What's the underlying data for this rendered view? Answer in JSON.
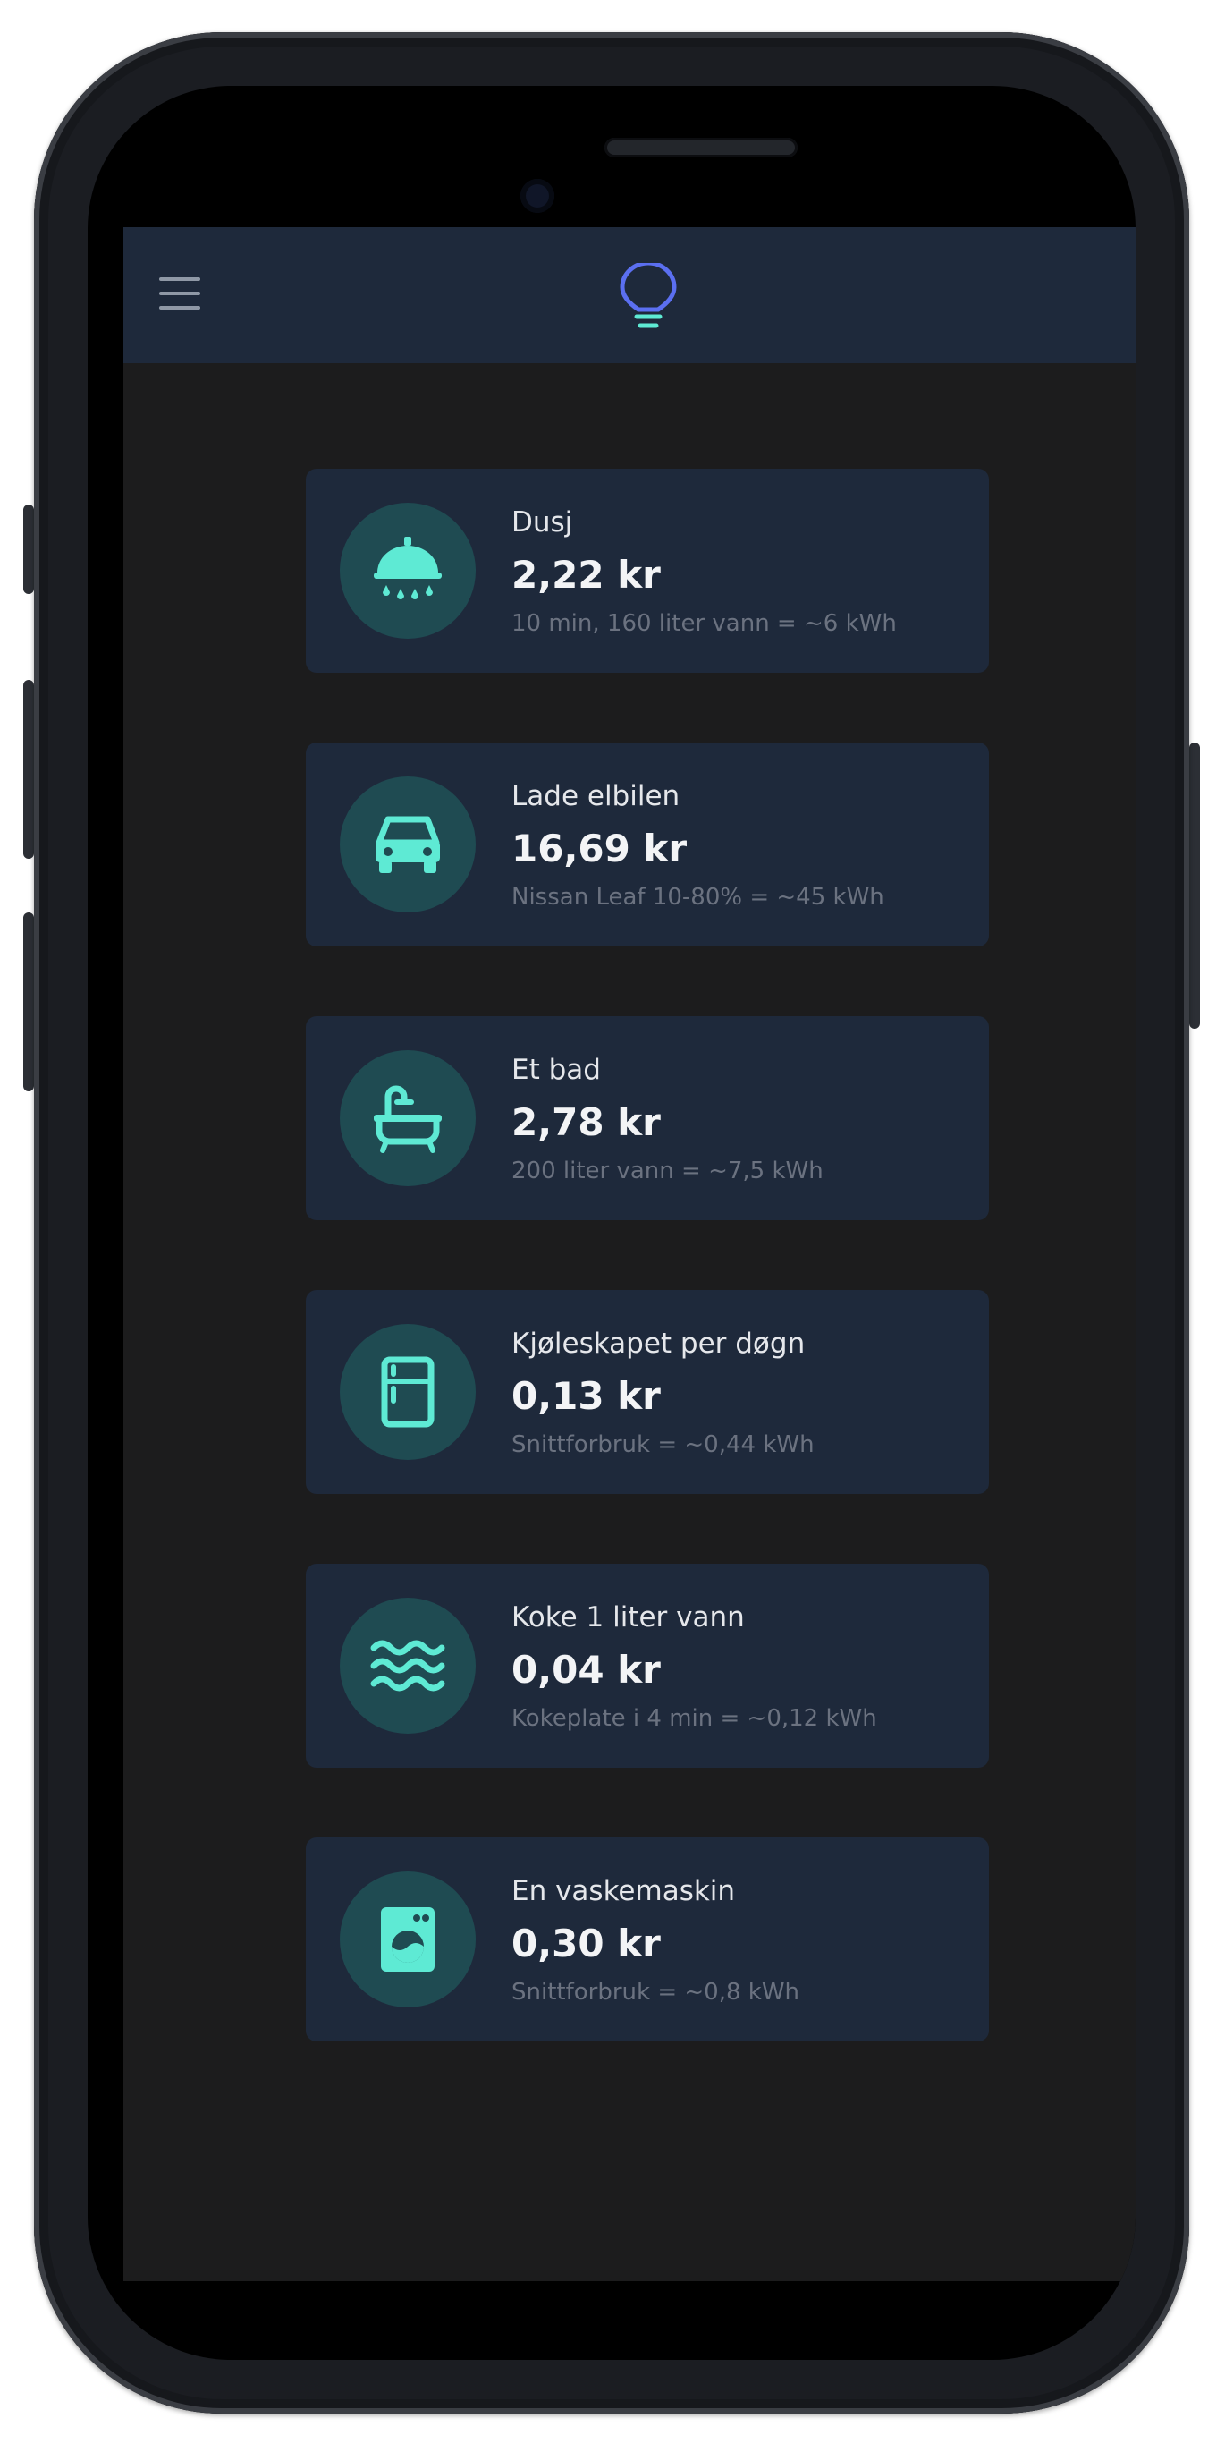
{
  "header": {
    "menu_icon": "hamburger-menu-icon",
    "logo_icon": "lightbulb-icon"
  },
  "colors": {
    "background": "#1c1c1d",
    "card": "#1e293b",
    "accent": "#5eead4",
    "icon_circle": "#1f4b52",
    "logo": "#5b6ff0"
  },
  "cards": [
    {
      "icon": "shower-icon",
      "title": "Dusj",
      "price": "2,22 kr",
      "detail": "10 min, 160 liter vann = ~6 kWh"
    },
    {
      "icon": "car-icon",
      "title": "Lade elbilen",
      "price": "16,69 kr",
      "detail": "Nissan Leaf 10-80% = ~45 kWh"
    },
    {
      "icon": "bathtub-icon",
      "title": "Et bad",
      "price": "2,78 kr",
      "detail": "200 liter vann = ~7,5 kWh"
    },
    {
      "icon": "refrigerator-icon",
      "title": "Kjøleskapet per døgn",
      "price": "0,13 kr",
      "detail": "Snittforbruk = ~0,44 kWh"
    },
    {
      "icon": "waves-icon",
      "title": "Koke 1 liter vann",
      "price": "0,04 kr",
      "detail": "Kokeplate i 4 min = ~0,12 kWh"
    },
    {
      "icon": "washing-machine-icon",
      "title": "En vaskemaskin",
      "price": "0,30 kr",
      "detail": "Snittforbruk = ~0,8 kWh"
    }
  ]
}
